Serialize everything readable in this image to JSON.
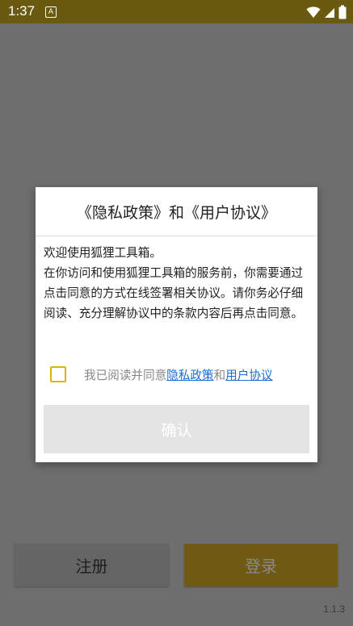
{
  "status_bar": {
    "time": "1:37",
    "notification_icon": "A"
  },
  "background": {
    "register_label": "注册",
    "login_label": "登录",
    "version": "1.1.3"
  },
  "dialog": {
    "title": "《隐私政策》和《用户协议》",
    "paragraphs": [
      "欢迎使用狐狸工具箱。",
      "在你访问和使用狐狸工具箱的服务前，你需要通过点击同意的方式在线签署相关协议。请你务必仔细阅读、充分理解协议中的条款内容后再点击同意。"
    ],
    "agree_prefix": "我已阅读并同意",
    "privacy_link": "隐私政策",
    "and_text": "和",
    "user_agreement_link": "用户协议",
    "checkbox_checked": false,
    "confirm_label": "确认"
  },
  "colors": {
    "status_bar": "#6a5a10",
    "overlay_bg": "#6e6e6e",
    "link": "#1a6fd8",
    "checkbox_border": "#e0b400",
    "confirm_bg": "#e4e4e4"
  }
}
